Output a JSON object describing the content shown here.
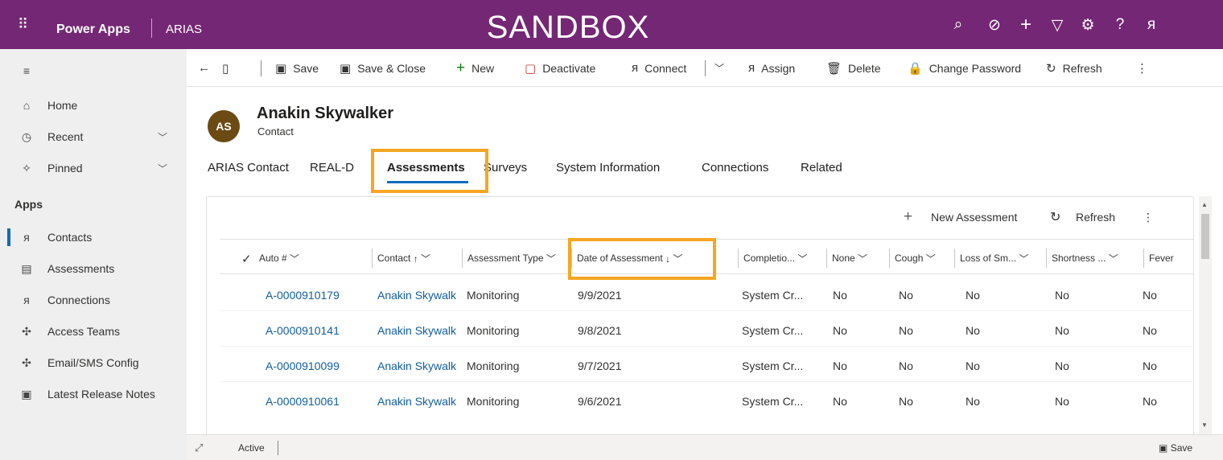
{
  "topbar": {
    "brand": "Power Apps",
    "app_name": "ARIAS",
    "environment": "SANDBOX",
    "icons": [
      "search-icon",
      "task-icon",
      "plus-icon",
      "filter-icon",
      "gear-icon",
      "help-icon",
      "person-icon"
    ],
    "color": "#742774"
  },
  "sidebar": {
    "items": [
      {
        "label": "Home",
        "icon": "home-icon"
      },
      {
        "label": "Recent",
        "icon": "clock-icon"
      },
      {
        "label": "Pinned",
        "icon": "pin-icon"
      }
    ],
    "apps_heading": "Apps",
    "apps": [
      {
        "label": "Contacts",
        "icon": "person-icon",
        "active": true
      },
      {
        "label": "Assessments",
        "icon": "clipboard-icon"
      },
      {
        "label": "Connections",
        "icon": "connections-icon"
      },
      {
        "label": "Access Teams",
        "icon": "puzzle-icon"
      },
      {
        "label": "Email/SMS Config",
        "icon": "puzzle-icon"
      },
      {
        "label": "Latest Release Notes",
        "icon": "notes-icon"
      }
    ]
  },
  "commandbar": {
    "save": "Save",
    "save_close": "Save & Close",
    "new": "New",
    "deactivate": "Deactivate",
    "connect": "Connect",
    "assign": "Assign",
    "delete": "Delete",
    "change_password": "Change Password",
    "refresh": "Refresh"
  },
  "record": {
    "initials": "AS",
    "name": "Anakin Skywalker",
    "entity": "Contact"
  },
  "tabs": [
    "ARIAS Contact",
    "REAL-D",
    "Assessments",
    "Surveys",
    "System Information",
    "Connections",
    "Related"
  ],
  "active_tab": "Assessments",
  "grid": {
    "new_label": "New Assessment",
    "refresh_label": "Refresh",
    "columns": [
      "Auto #",
      "Contact",
      "Assessment Type",
      "Date of Assessment",
      "Completio...",
      "None",
      "Cough",
      "Loss of Sm...",
      "Shortness ...",
      "Fever"
    ],
    "rows": [
      [
        "A-0000910179",
        "Anakin Skywalk",
        "Monitoring",
        "9/9/2021",
        "System Cr...",
        "No",
        "No",
        "No",
        "No",
        "No"
      ],
      [
        "A-0000910141",
        "Anakin Skywalk",
        "Monitoring",
        "9/8/2021",
        "System Cr...",
        "No",
        "No",
        "No",
        "No",
        "No"
      ],
      [
        "A-0000910099",
        "Anakin Skywalk",
        "Monitoring",
        "9/7/2021",
        "System Cr...",
        "No",
        "No",
        "No",
        "No",
        "No"
      ],
      [
        "A-0000910061",
        "Anakin Skywalk",
        "Monitoring",
        "9/6/2021",
        "System Cr...",
        "No",
        "No",
        "No",
        "No",
        "No"
      ]
    ]
  },
  "footer": {
    "status": "Active",
    "save": "Save"
  },
  "highlight_color": "#f5a623"
}
